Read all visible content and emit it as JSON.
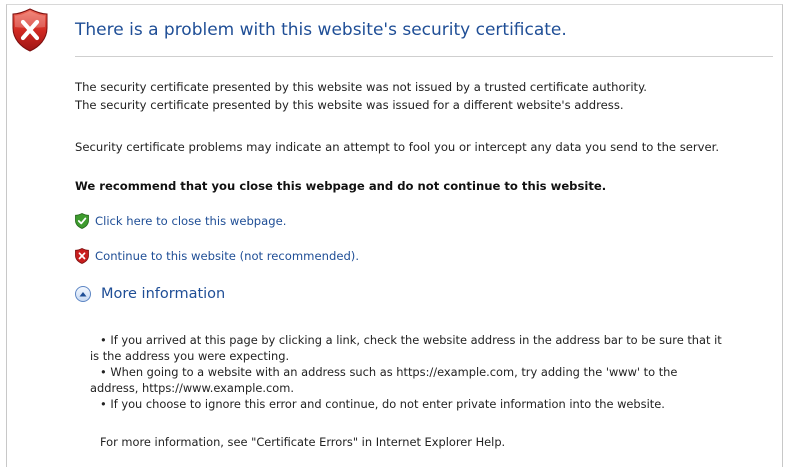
{
  "page": {
    "title": "There is a problem with this website's security certificate.",
    "details": [
      "The security certificate presented by this website was not issued by a trusted certificate authority.",
      "The security certificate presented by this website was issued for a different website's address."
    ],
    "warning": "Security certificate problems may indicate an attempt to fool you or intercept any data you send to the server.",
    "recommendation": "We recommend that you close this webpage and do not continue to this website.",
    "close_link": "Click here to close this webpage.",
    "continue_link": "Continue to this website (not recommended).",
    "more_info_label": "More information",
    "more_info_bullets": [
      "•  If you arrived at this page by clicking a link, check the website address in the address bar to be sure that it",
      "is the address you were expecting.",
      "•  When going to a website with an address such as https://example.com, try adding the 'www' to the",
      "address, https://www.example.com.",
      "•  If you choose to ignore this error and continue, do not enter private information into the website."
    ],
    "footer": "For more information, see \"Certificate Errors\" in Internet Explorer Help."
  },
  "colors": {
    "link": "#1f4e96",
    "shield_red": "#c81e1e",
    "shield_green": "#3e9b2e"
  },
  "icons": {
    "header": "error-shield-icon",
    "close_link": "green-check-shield-icon",
    "continue_link": "red-x-shield-icon",
    "more_info": "expand-toggle-icon"
  }
}
